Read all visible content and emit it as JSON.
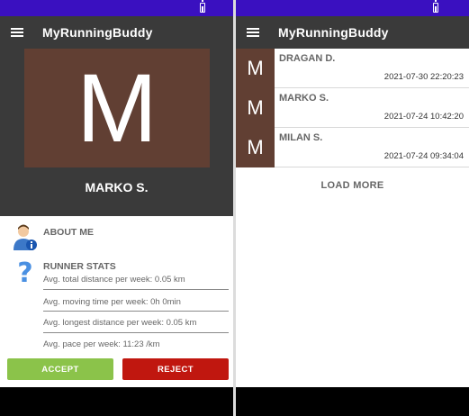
{
  "app": {
    "title": "MyRunningBuddy"
  },
  "profile": {
    "avatar_letter": "M",
    "name": "MARKO S.",
    "about_title": "ABOUT ME",
    "stats_title": "RUNNER STATS",
    "stats": [
      "Avg. total distance per week: 0.05 km",
      "Avg. moving time per week: 0h 0min",
      "Avg. longest distance per week: 0.05 km",
      "Avg. pace per week: 11:23 /km"
    ],
    "accept_label": "ACCEPT",
    "reject_label": "REJECT"
  },
  "requests": {
    "items": [
      {
        "letter": "M",
        "name": "DRAGAN D.",
        "datetime": "2021-07-30 22:20:23"
      },
      {
        "letter": "M",
        "name": "MARKO S.",
        "datetime": "2021-07-24 10:42:20"
      },
      {
        "letter": "M",
        "name": "MILAN S.",
        "datetime": "2021-07-24 09:34:04"
      }
    ],
    "load_more_label": "LOAD MORE"
  },
  "colors": {
    "status_bar": "#3a10c0",
    "app_bar": "#3a3a3a",
    "avatar_bg": "#613f33",
    "accept": "#8bc34a",
    "reject": "#c0170f"
  },
  "icons": [
    "menu-icon",
    "battery-icon",
    "person-info-icon",
    "question-mark-icon"
  ]
}
